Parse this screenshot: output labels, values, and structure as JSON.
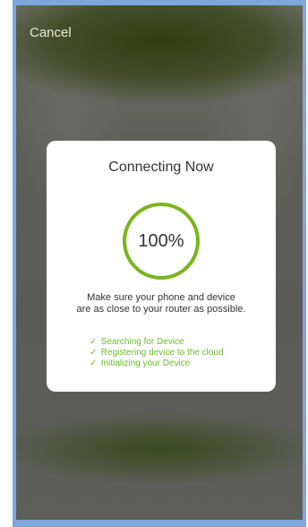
{
  "header": {
    "cancel_label": "Cancel"
  },
  "dialog": {
    "title": "Connecting Now",
    "progress_label": "100%",
    "progress_value": 1.0,
    "hint_line1": "Make sure your phone and device",
    "hint_line2": "are as close to your router as possible.",
    "steps": [
      {
        "icon": "check-icon",
        "label": "Searching for Device"
      },
      {
        "icon": "check-icon",
        "label": "Registering device to the cloud"
      },
      {
        "icon": "check-icon",
        "label": "Initializing your Device"
      }
    ]
  },
  "colors": {
    "accent": "#7ab51d",
    "step_text": "#6dbb2b"
  }
}
